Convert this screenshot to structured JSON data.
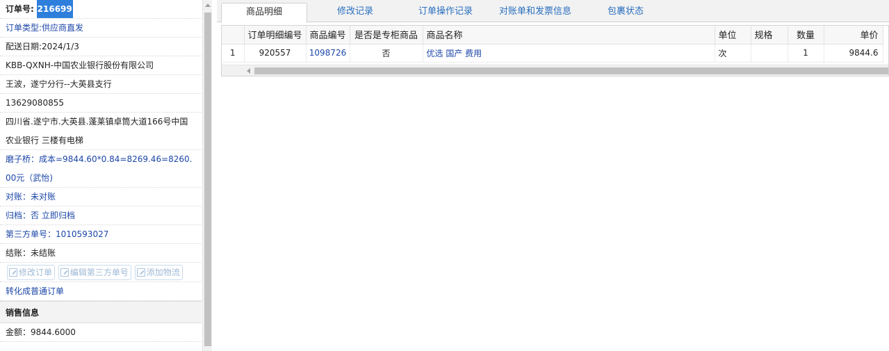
{
  "left": {
    "order_no_label": "订单号:",
    "order_no_value": "216699",
    "order_type": "订单类型:供应商直发",
    "delivery_date": "配送日期:2024/1/3",
    "company": "KBB-QXNH-中国农业银行股份有限公司",
    "contact": "王波，遂宁分行--大英县支行",
    "phone": "13629080855",
    "address": "四川省.遂宁市.大英县.蓬莱镇卓筒大道166号中国农业银行 三楼有电梯",
    "cost_note": "磨子桥：成本=9844.60*0.84=8269.46=8260.00元（武怡)",
    "reconcile": "对账：未对账",
    "archive": "归档：否 立即归档",
    "third_party_no": "第三方单号：1010593027",
    "settlement": "结账：未结账",
    "buttons": [
      "修改订单",
      "编辑第三方单号",
      "添加物流"
    ],
    "convert_link": "转化成普通订单",
    "sales_header": "销售信息",
    "amount": "金额：9844.6000"
  },
  "tabs": [
    "商品明细",
    "修改记录",
    "订单操作记录",
    "对账单和发票信息",
    "包裹状态"
  ],
  "active_tab": 0,
  "grid": {
    "headers": [
      "",
      "订单明细编号",
      "商品编号",
      "是否是专柜商品",
      "商品名称",
      "单位",
      "规格",
      "数量",
      "单价"
    ],
    "rows": [
      [
        "1",
        "920557",
        "1098726",
        "否",
        "优选 国产 费用",
        "次",
        "",
        "1",
        "9844.6"
      ]
    ]
  },
  "icons": {
    "edit_icon": "pencil-square-icon"
  }
}
